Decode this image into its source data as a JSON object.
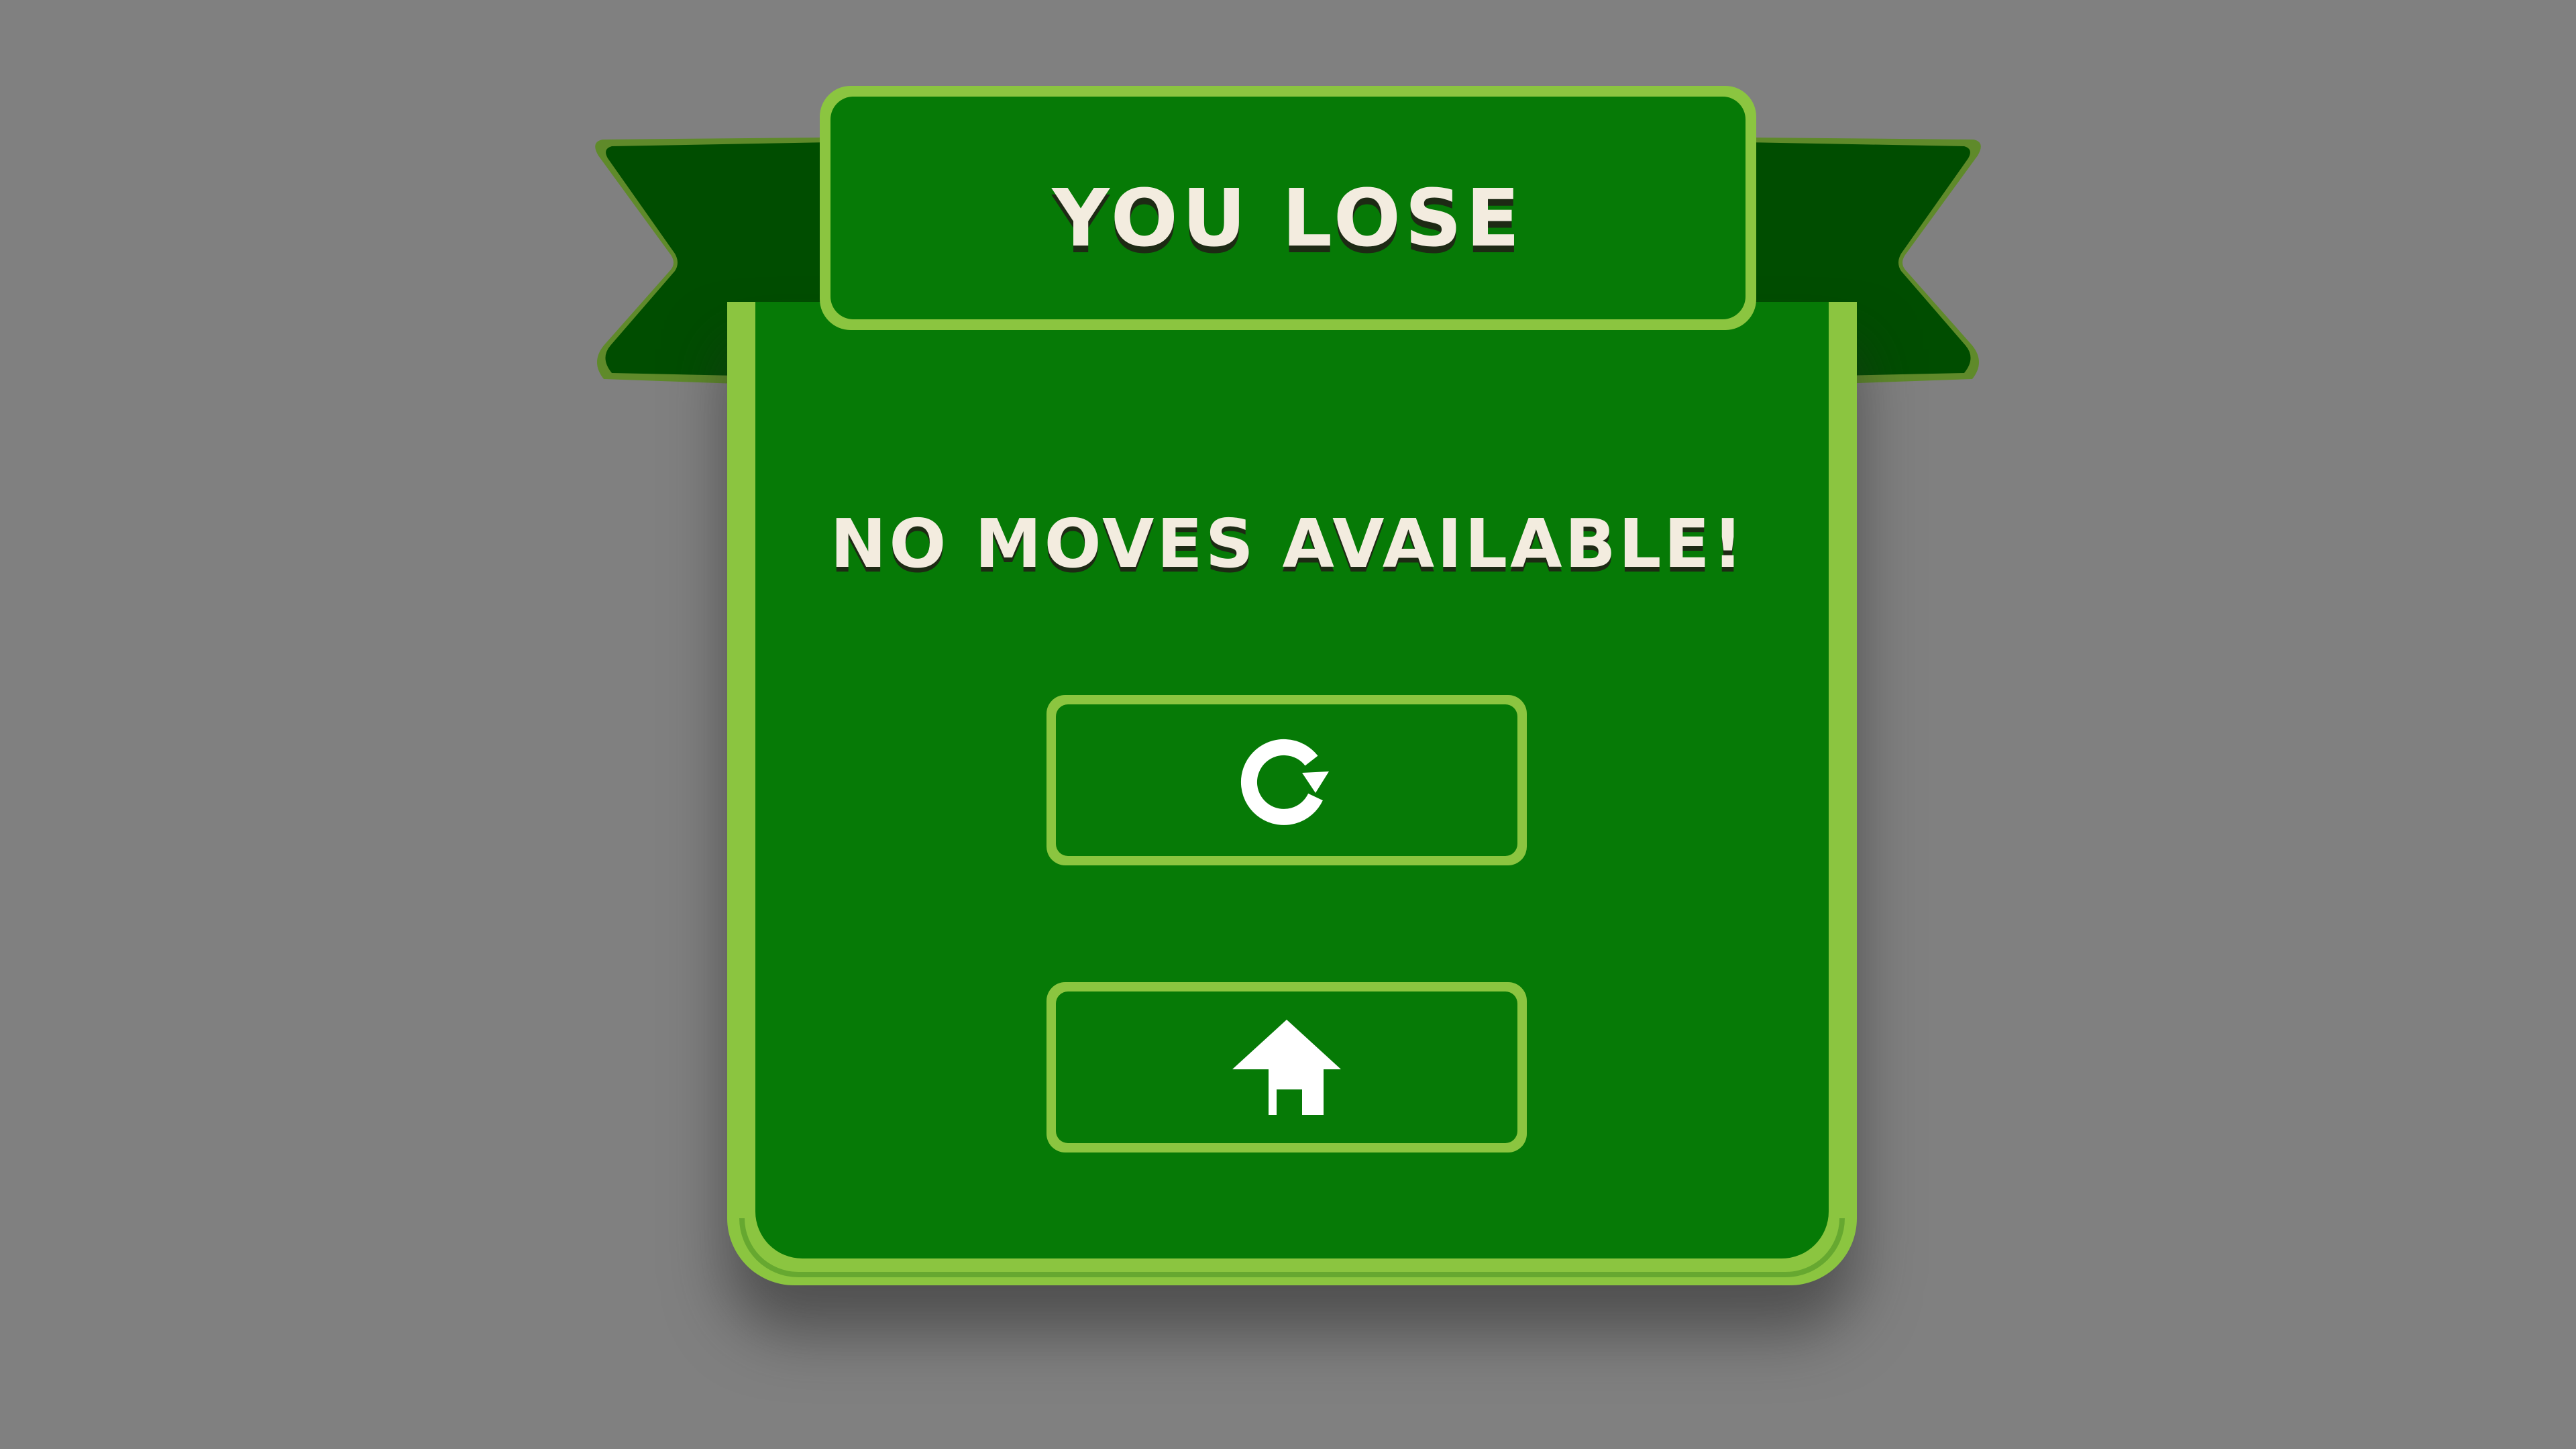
{
  "dialog": {
    "title": "YOU LOSE",
    "message": "NO MOVES AVAILABLE!"
  },
  "buttons": [
    {
      "id": "restart",
      "icon": "restart-icon"
    },
    {
      "id": "home",
      "icon": "home-icon"
    }
  ],
  "colors": {
    "background": "#808080",
    "panel_fill": "#067a06",
    "panel_border": "#8bc540",
    "ribbon_dark": "#004d00",
    "ribbon_fold": "#5f8a2a",
    "text": "#f3ecdf"
  }
}
